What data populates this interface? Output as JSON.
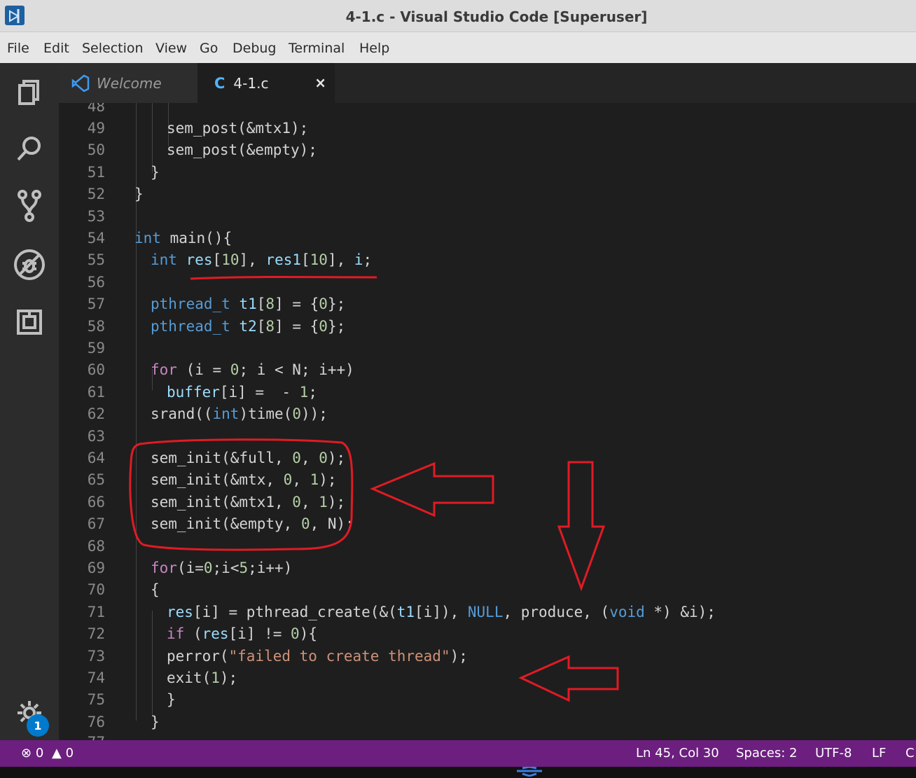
{
  "window": {
    "title": "4-1.c - Visual Studio Code [Superuser]"
  },
  "menu": [
    "File",
    "Edit",
    "Selection",
    "View",
    "Go",
    "Debug",
    "Terminal",
    "Help"
  ],
  "activity_bar": {
    "items": [
      "explorer-icon",
      "search-icon",
      "source-control-icon",
      "debug-icon",
      "extensions-icon"
    ],
    "settings_badge": "1"
  },
  "tabs": [
    {
      "label": "Welcome",
      "icon": "vscode-logo-icon",
      "active": false
    },
    {
      "label": "4-1.c",
      "icon_text": "C",
      "active": true,
      "close": "×"
    }
  ],
  "editor": {
    "first_partial_line": "48",
    "last_partial_line": "77",
    "lines": [
      {
        "n": "49",
        "code": "sem_post(&mtx1);"
      },
      {
        "n": "50",
        "code": "sem_post(&empty);"
      },
      {
        "n": "51",
        "code": "}"
      },
      {
        "n": "52",
        "code": "}"
      },
      {
        "n": "53",
        "code": ""
      },
      {
        "n": "54",
        "code": "int main(){"
      },
      {
        "n": "55",
        "code": "int res[10], res1[10], i;"
      },
      {
        "n": "56",
        "code": ""
      },
      {
        "n": "57",
        "code": "pthread_t t1[8] = {0};"
      },
      {
        "n": "58",
        "code": "pthread_t t2[8] = {0};"
      },
      {
        "n": "59",
        "code": ""
      },
      {
        "n": "60",
        "code": "for (i = 0; i < N; i++)"
      },
      {
        "n": "61",
        "code": "buffer[i] =  - 1;"
      },
      {
        "n": "62",
        "code": "srand((int)time(0));"
      },
      {
        "n": "63",
        "code": ""
      },
      {
        "n": "64",
        "code": "sem_init(&full, 0, 0);"
      },
      {
        "n": "65",
        "code": "sem_init(&mtx, 0, 1);"
      },
      {
        "n": "66",
        "code": "sem_init(&mtx1, 0, 1);"
      },
      {
        "n": "67",
        "code": "sem_init(&empty, 0, N);"
      },
      {
        "n": "68",
        "code": ""
      },
      {
        "n": "69",
        "code": "for(i=0;i<5;i++)"
      },
      {
        "n": "70",
        "code": "{"
      },
      {
        "n": "71",
        "code": "res[i] = pthread_create(&(t1[i]), NULL, produce, (void *) &i);"
      },
      {
        "n": "72",
        "code": "if (res[i] != 0){"
      },
      {
        "n": "73",
        "code": "perror(\"failed to create thread\");"
      },
      {
        "n": "74",
        "code": "exit(1);"
      },
      {
        "n": "75",
        "code": "}"
      },
      {
        "n": "76",
        "code": "}"
      }
    ]
  },
  "status": {
    "errors": "0",
    "warnings": "0",
    "position": "Ln 45, Col 30",
    "spaces": "Spaces: 2",
    "encoding": "UTF-8",
    "eol": "LF",
    "language": "C"
  },
  "colors": {
    "keyword": "#569cd6",
    "number": "#b5cea8",
    "string": "#ce9178",
    "variable": "#9cdcfe",
    "status_bar": "#6c1f7f",
    "annotation": "#e01b24"
  }
}
